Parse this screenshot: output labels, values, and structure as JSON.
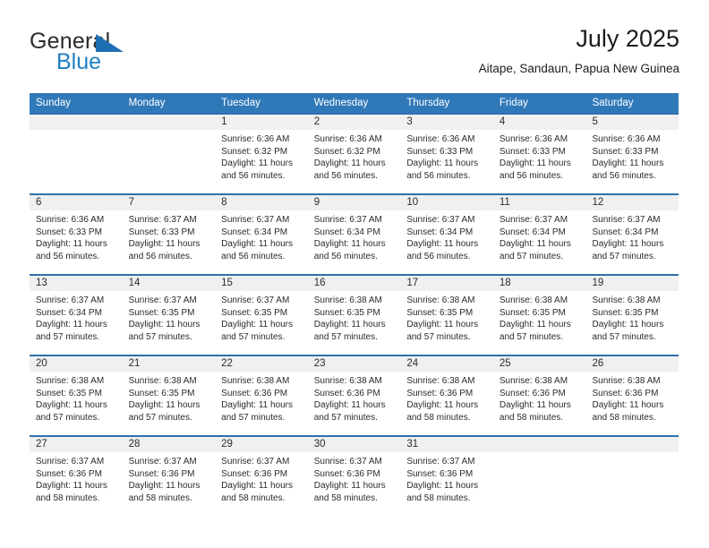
{
  "brand": {
    "name_top": "General",
    "name_bottom": "Blue"
  },
  "header": {
    "title": "July 2025",
    "subtitle": "Aitape, Sandaun, Papua New Guinea"
  },
  "colors": {
    "header_blue": "#3079b8",
    "row_rule_blue": "#2f6fad",
    "band_gray": "#f0f0f0",
    "brand_blue": "#1f7fc4",
    "text": "#2b2b2b"
  },
  "weekdays": [
    "Sunday",
    "Monday",
    "Tuesday",
    "Wednesday",
    "Thursday",
    "Friday",
    "Saturday"
  ],
  "weeks": [
    [
      {
        "day": "",
        "empty": true
      },
      {
        "day": "",
        "empty": true
      },
      {
        "day": "1",
        "sunrise": "Sunrise: 6:36 AM",
        "sunset": "Sunset: 6:32 PM",
        "daylight1": "Daylight: 11 hours",
        "daylight2": "and 56 minutes."
      },
      {
        "day": "2",
        "sunrise": "Sunrise: 6:36 AM",
        "sunset": "Sunset: 6:32 PM",
        "daylight1": "Daylight: 11 hours",
        "daylight2": "and 56 minutes."
      },
      {
        "day": "3",
        "sunrise": "Sunrise: 6:36 AM",
        "sunset": "Sunset: 6:33 PM",
        "daylight1": "Daylight: 11 hours",
        "daylight2": "and 56 minutes."
      },
      {
        "day": "4",
        "sunrise": "Sunrise: 6:36 AM",
        "sunset": "Sunset: 6:33 PM",
        "daylight1": "Daylight: 11 hours",
        "daylight2": "and 56 minutes."
      },
      {
        "day": "5",
        "sunrise": "Sunrise: 6:36 AM",
        "sunset": "Sunset: 6:33 PM",
        "daylight1": "Daylight: 11 hours",
        "daylight2": "and 56 minutes."
      }
    ],
    [
      {
        "day": "6",
        "sunrise": "Sunrise: 6:36 AM",
        "sunset": "Sunset: 6:33 PM",
        "daylight1": "Daylight: 11 hours",
        "daylight2": "and 56 minutes."
      },
      {
        "day": "7",
        "sunrise": "Sunrise: 6:37 AM",
        "sunset": "Sunset: 6:33 PM",
        "daylight1": "Daylight: 11 hours",
        "daylight2": "and 56 minutes."
      },
      {
        "day": "8",
        "sunrise": "Sunrise: 6:37 AM",
        "sunset": "Sunset: 6:34 PM",
        "daylight1": "Daylight: 11 hours",
        "daylight2": "and 56 minutes."
      },
      {
        "day": "9",
        "sunrise": "Sunrise: 6:37 AM",
        "sunset": "Sunset: 6:34 PM",
        "daylight1": "Daylight: 11 hours",
        "daylight2": "and 56 minutes."
      },
      {
        "day": "10",
        "sunrise": "Sunrise: 6:37 AM",
        "sunset": "Sunset: 6:34 PM",
        "daylight1": "Daylight: 11 hours",
        "daylight2": "and 56 minutes."
      },
      {
        "day": "11",
        "sunrise": "Sunrise: 6:37 AM",
        "sunset": "Sunset: 6:34 PM",
        "daylight1": "Daylight: 11 hours",
        "daylight2": "and 57 minutes."
      },
      {
        "day": "12",
        "sunrise": "Sunrise: 6:37 AM",
        "sunset": "Sunset: 6:34 PM",
        "daylight1": "Daylight: 11 hours",
        "daylight2": "and 57 minutes."
      }
    ],
    [
      {
        "day": "13",
        "sunrise": "Sunrise: 6:37 AM",
        "sunset": "Sunset: 6:34 PM",
        "daylight1": "Daylight: 11 hours",
        "daylight2": "and 57 minutes."
      },
      {
        "day": "14",
        "sunrise": "Sunrise: 6:37 AM",
        "sunset": "Sunset: 6:35 PM",
        "daylight1": "Daylight: 11 hours",
        "daylight2": "and 57 minutes."
      },
      {
        "day": "15",
        "sunrise": "Sunrise: 6:37 AM",
        "sunset": "Sunset: 6:35 PM",
        "daylight1": "Daylight: 11 hours",
        "daylight2": "and 57 minutes."
      },
      {
        "day": "16",
        "sunrise": "Sunrise: 6:38 AM",
        "sunset": "Sunset: 6:35 PM",
        "daylight1": "Daylight: 11 hours",
        "daylight2": "and 57 minutes."
      },
      {
        "day": "17",
        "sunrise": "Sunrise: 6:38 AM",
        "sunset": "Sunset: 6:35 PM",
        "daylight1": "Daylight: 11 hours",
        "daylight2": "and 57 minutes."
      },
      {
        "day": "18",
        "sunrise": "Sunrise: 6:38 AM",
        "sunset": "Sunset: 6:35 PM",
        "daylight1": "Daylight: 11 hours",
        "daylight2": "and 57 minutes."
      },
      {
        "day": "19",
        "sunrise": "Sunrise: 6:38 AM",
        "sunset": "Sunset: 6:35 PM",
        "daylight1": "Daylight: 11 hours",
        "daylight2": "and 57 minutes."
      }
    ],
    [
      {
        "day": "20",
        "sunrise": "Sunrise: 6:38 AM",
        "sunset": "Sunset: 6:35 PM",
        "daylight1": "Daylight: 11 hours",
        "daylight2": "and 57 minutes."
      },
      {
        "day": "21",
        "sunrise": "Sunrise: 6:38 AM",
        "sunset": "Sunset: 6:35 PM",
        "daylight1": "Daylight: 11 hours",
        "daylight2": "and 57 minutes."
      },
      {
        "day": "22",
        "sunrise": "Sunrise: 6:38 AM",
        "sunset": "Sunset: 6:36 PM",
        "daylight1": "Daylight: 11 hours",
        "daylight2": "and 57 minutes."
      },
      {
        "day": "23",
        "sunrise": "Sunrise: 6:38 AM",
        "sunset": "Sunset: 6:36 PM",
        "daylight1": "Daylight: 11 hours",
        "daylight2": "and 57 minutes."
      },
      {
        "day": "24",
        "sunrise": "Sunrise: 6:38 AM",
        "sunset": "Sunset: 6:36 PM",
        "daylight1": "Daylight: 11 hours",
        "daylight2": "and 58 minutes."
      },
      {
        "day": "25",
        "sunrise": "Sunrise: 6:38 AM",
        "sunset": "Sunset: 6:36 PM",
        "daylight1": "Daylight: 11 hours",
        "daylight2": "and 58 minutes."
      },
      {
        "day": "26",
        "sunrise": "Sunrise: 6:38 AM",
        "sunset": "Sunset: 6:36 PM",
        "daylight1": "Daylight: 11 hours",
        "daylight2": "and 58 minutes."
      }
    ],
    [
      {
        "day": "27",
        "sunrise": "Sunrise: 6:37 AM",
        "sunset": "Sunset: 6:36 PM",
        "daylight1": "Daylight: 11 hours",
        "daylight2": "and 58 minutes."
      },
      {
        "day": "28",
        "sunrise": "Sunrise: 6:37 AM",
        "sunset": "Sunset: 6:36 PM",
        "daylight1": "Daylight: 11 hours",
        "daylight2": "and 58 minutes."
      },
      {
        "day": "29",
        "sunrise": "Sunrise: 6:37 AM",
        "sunset": "Sunset: 6:36 PM",
        "daylight1": "Daylight: 11 hours",
        "daylight2": "and 58 minutes."
      },
      {
        "day": "30",
        "sunrise": "Sunrise: 6:37 AM",
        "sunset": "Sunset: 6:36 PM",
        "daylight1": "Daylight: 11 hours",
        "daylight2": "and 58 minutes."
      },
      {
        "day": "31",
        "sunrise": "Sunrise: 6:37 AM",
        "sunset": "Sunset: 6:36 PM",
        "daylight1": "Daylight: 11 hours",
        "daylight2": "and 58 minutes."
      },
      {
        "day": "",
        "empty": true
      },
      {
        "day": "",
        "empty": true
      }
    ]
  ]
}
